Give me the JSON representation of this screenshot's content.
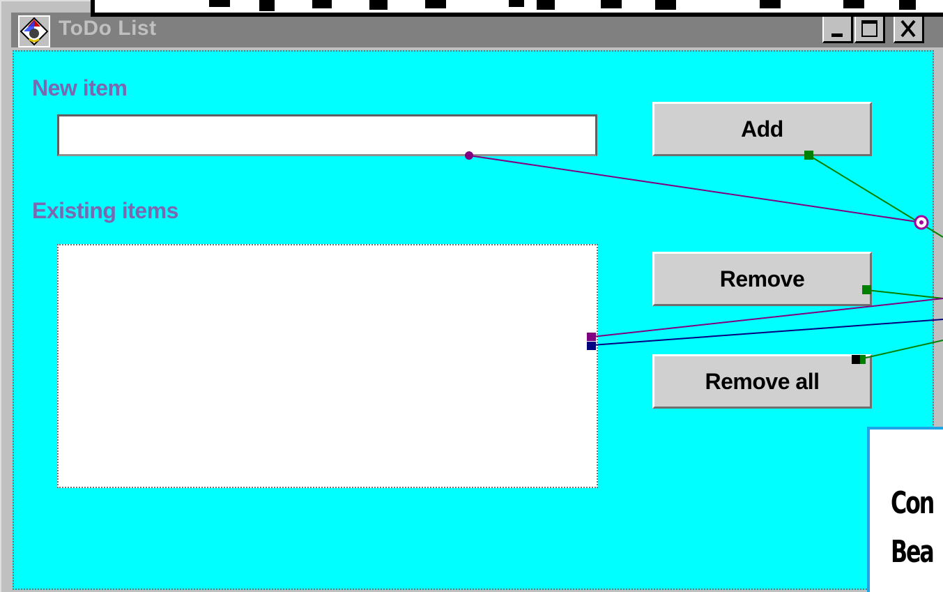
{
  "window": {
    "title": "ToDo List",
    "icon": "java-cup-icon",
    "controls": [
      "minimize-icon",
      "maximize-icon",
      "close-icon"
    ]
  },
  "form": {
    "new_item_label": "New item",
    "new_item_value": "",
    "existing_items_label": "Existing items",
    "existing_items": []
  },
  "buttons": {
    "add": "Add",
    "remove": "Remove",
    "remove_all": "Remove all"
  },
  "callout": {
    "line1": "Con",
    "line2": "Bea"
  },
  "colors": {
    "client_background": "#00ffff",
    "label_text": "#7a68b0",
    "button_face": "#d0d0d0",
    "title_bar": "#808080",
    "wire_purple": "#800080",
    "wire_green": "#008000",
    "wire_navy": "#000080",
    "callout_border": "#1aa7e8"
  }
}
